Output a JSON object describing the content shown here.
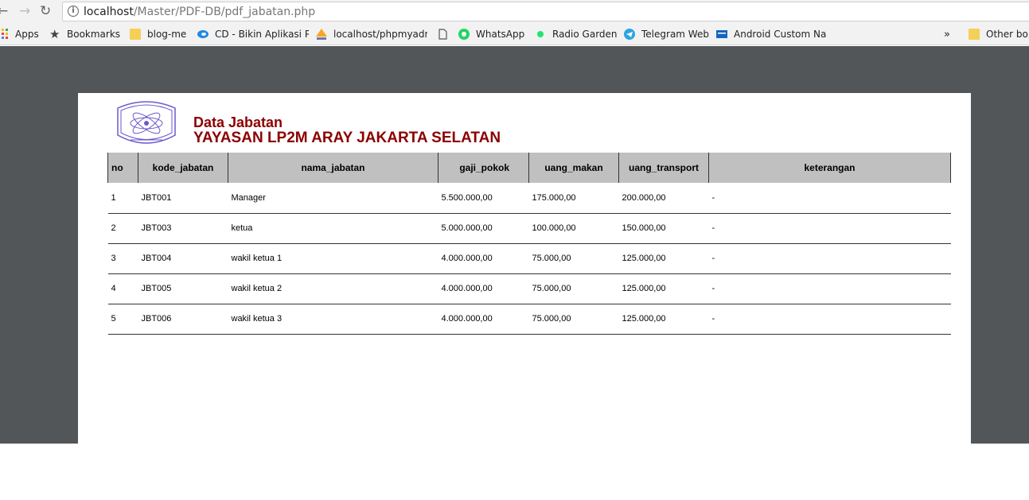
{
  "browser": {
    "back_icon": "arrow-left-icon",
    "forward_icon": "arrow-right-icon",
    "reload_icon": "reload-icon",
    "url_host": "localhost",
    "url_path": "/Master/PDF-DB/pdf_jabatan.php",
    "bookmarks": [
      {
        "label": "Apps",
        "icon": "apps-grid-icon"
      },
      {
        "label": "Bookmarks",
        "icon": "star-icon"
      },
      {
        "label": "blog-me",
        "icon": "folder-icon"
      },
      {
        "label": "CD - Bikin Aplikasi P",
        "icon": "cd-icon"
      },
      {
        "label": "localhost/phpmyadm",
        "icon": "pma-icon"
      },
      {
        "label": "",
        "icon": "page-icon"
      },
      {
        "label": "WhatsApp",
        "icon": "whatsapp-icon"
      },
      {
        "label": "Radio Garden",
        "icon": "radio-garden-icon"
      },
      {
        "label": "Telegram Web",
        "icon": "telegram-icon"
      },
      {
        "label": "Android Custom Na",
        "icon": "tc-icon"
      }
    ],
    "overflow_label": "»",
    "other_label": "Other bo"
  },
  "document": {
    "title": "Data Jabatan",
    "subtitle": "YAYASAN LP2M ARAY JAKARTA SELATAN",
    "table": {
      "headers": [
        "no",
        "kode_jabatan",
        "nama_jabatan",
        "gaji_pokok",
        "uang_makan",
        "uang_transport",
        "keterangan"
      ],
      "rows": [
        [
          "1",
          "JBT001",
          "Manager",
          "5.500.000,00",
          "175.000,00",
          "200.000,00",
          "-"
        ],
        [
          "2",
          "JBT003",
          "ketua",
          "5.000.000,00",
          "100.000,00",
          "150.000,00",
          "-"
        ],
        [
          "3",
          "JBT004",
          "wakil ketua 1",
          "4.000.000,00",
          "75.000,00",
          "125.000,00",
          "-"
        ],
        [
          "4",
          "JBT005",
          "wakil ketua 2",
          "4.000.000,00",
          "75.000,00",
          "125.000,00",
          "-"
        ],
        [
          "5",
          "JBT006",
          "wakil ketua 3",
          "4.000.000,00",
          "75.000,00",
          "125.000,00",
          "-"
        ]
      ]
    }
  },
  "colors": {
    "title": "#8b0000",
    "header_bg": "#c0c0c0",
    "viewer_bg": "#525659"
  }
}
